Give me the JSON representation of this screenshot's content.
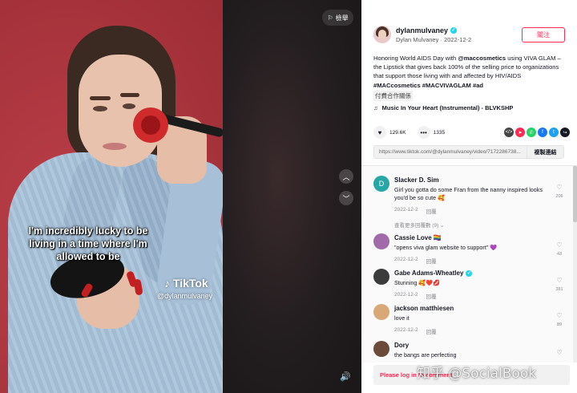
{
  "video": {
    "caption": "I'm incredibly lucky to be living in a time where I'm allowed to be",
    "tiktok_logo": "TikTok",
    "watermark_handle": "@dylanmulvaney",
    "report_label": "檢舉",
    "nav_up_icon": "chevron-up-icon",
    "nav_down_icon": "chevron-down-icon",
    "sound_icon": "speaker-icon"
  },
  "author": {
    "username": "dylanmulvaney",
    "display_name": "Dylan Mulvaney",
    "date": "2022-12-2",
    "sub_line": "Dylan Mulvaney · 2022-12-2",
    "follow_label": "關注"
  },
  "post": {
    "description_parts": [
      {
        "text": "Honoring World AIDS Day with ",
        "bold": false
      },
      {
        "text": "@maccosmetics",
        "bold": true
      },
      {
        "text": " using VIVA GLAM – the Lipstick that gives back 100% of the selling price to organizations that support those living with and affected by HIV/AIDS ",
        "bold": false
      },
      {
        "text": "#MACcosmetics",
        "bold": true
      },
      {
        "text": " ",
        "bold": false
      },
      {
        "text": "#MACVIVAGLAM",
        "bold": true
      },
      {
        "text": " ",
        "bold": false
      },
      {
        "text": "#ad",
        "bold": true
      }
    ],
    "paid_partnership": "付費合作關係",
    "music": "Music In Your Heart (Instrumental) - BLVKSHP",
    "likes": "129.6K",
    "comments": "1335",
    "url": "https://www.tiktok.com/@dylanmulvaney/video/7172286738...",
    "copy_link_label": "複製連結"
  },
  "share_icons": [
    {
      "name": "embed-icon",
      "glyph": "</>",
      "color": "#444444"
    },
    {
      "name": "send-icon",
      "glyph": "➤",
      "color": "#fe2c55"
    },
    {
      "name": "whatsapp-icon",
      "glyph": "✆",
      "color": "#25d366"
    },
    {
      "name": "facebook-icon",
      "glyph": "f",
      "color": "#1877f2"
    },
    {
      "name": "twitter-icon",
      "glyph": "t",
      "color": "#1da1f2"
    },
    {
      "name": "share-arrow-icon",
      "glyph": "↪",
      "color": "#161823"
    }
  ],
  "comments": [
    {
      "name": "Slacker D. Sim",
      "text": "Girl you gotta do some Fran from the nanny inspired looks you'd be so cute 🥰",
      "date": "2022-12-2",
      "reply": "回覆",
      "likes": "206",
      "avatar_letter": "D",
      "avatar_color": "#27a6a6",
      "verified": false,
      "view_replies": "查看更多回覆數 (9) ⌄"
    },
    {
      "name": "Cassie Love 🏳️‍🌈",
      "text": "\"opens viva glam website to support\" 💜",
      "date": "2022-12-2",
      "reply": "回覆",
      "likes": "43",
      "avatar_letter": "",
      "avatar_color": "#a16aa8",
      "verified": false
    },
    {
      "name": "Gabe Adams-Wheatley",
      "text": "Stunning 🥰❤️💋",
      "date": "2022-12-2",
      "reply": "回覆",
      "likes": "381",
      "avatar_letter": "",
      "avatar_color": "#3b3b3b",
      "verified": true
    },
    {
      "name": "jackson matthiesen",
      "text": "love it",
      "date": "2022-12-2",
      "reply": "回覆",
      "likes": "89",
      "avatar_letter": "",
      "avatar_color": "#d8a877",
      "verified": false
    },
    {
      "name": "Dory",
      "text": "the bangs are perfecting",
      "date": "",
      "reply": "",
      "likes": "",
      "avatar_letter": "",
      "avatar_color": "#6b4a3a",
      "verified": false
    }
  ],
  "login_prompt": "Please log in to comment",
  "overlay_watermark": "知乎 @SocialBook"
}
